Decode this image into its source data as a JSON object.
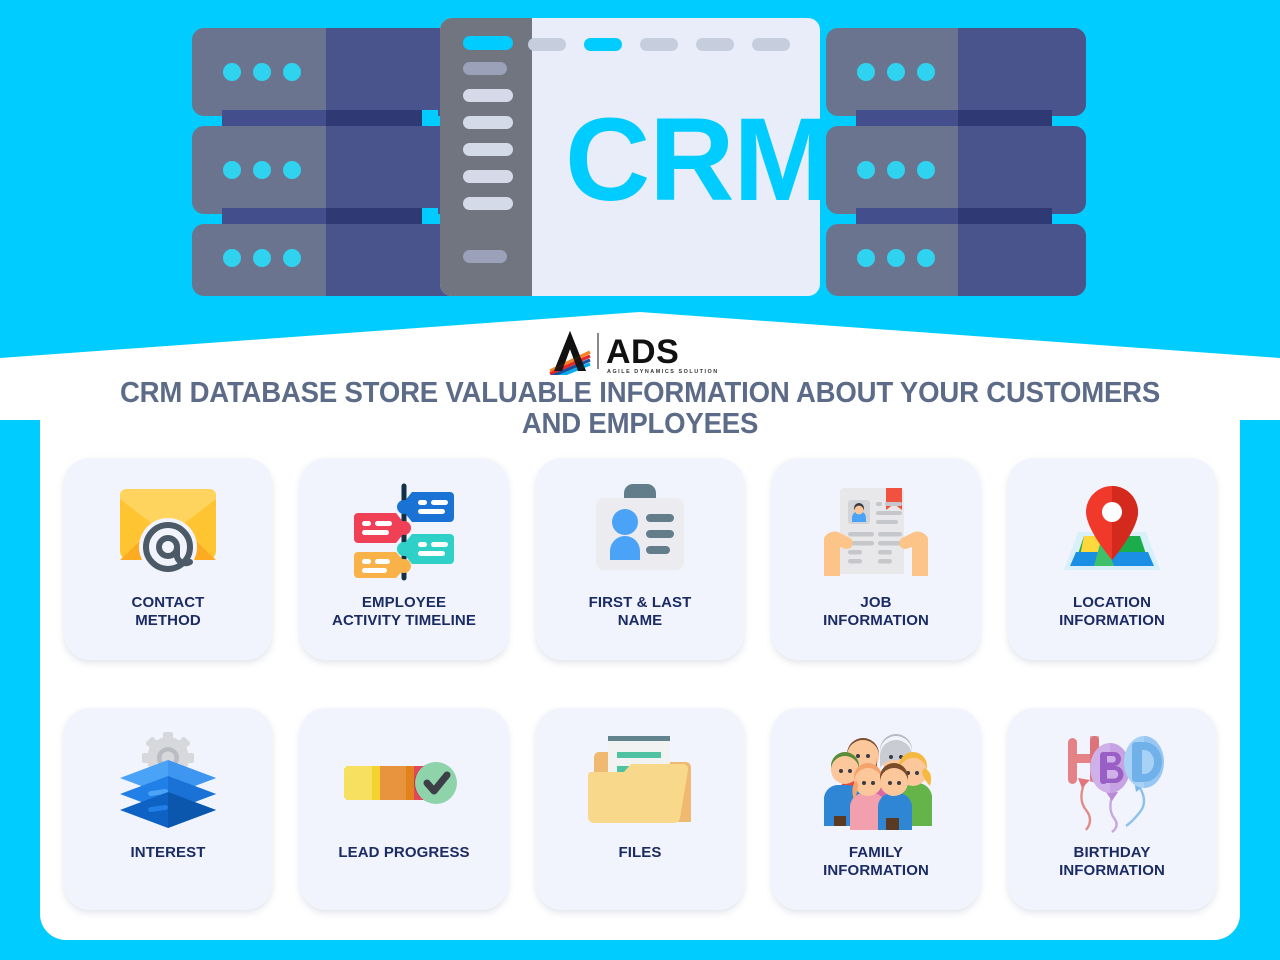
{
  "theme": {
    "background_color": "#00ccff",
    "panel_color": "#ffffff",
    "card_color": "#f2f4fd",
    "heading_color": "#5c6b87",
    "label_color": "#1b2b63",
    "crm_text_color": "#00ccff"
  },
  "hero": {
    "crm_label": "CRM",
    "nav_dots": [
      "inactive",
      "active",
      "inactive",
      "inactive",
      "inactive"
    ],
    "server_racks": 3,
    "server_lights_per_rack": 3
  },
  "logo": {
    "wordmark": "ADS",
    "tagline": "AGILE DYNAMICS SOLUTIONS",
    "mark_colors": [
      "#f58220",
      "#e8262a",
      "#1b4f9c",
      "#00aeef"
    ]
  },
  "heading": {
    "text": "CRM DATABASE STORE VALUABLE INFORMATION ABOUT YOUR CUSTOMERS AND EMPLOYEES"
  },
  "cards": [
    {
      "id": "contact-method",
      "icon": "envelope-at-icon",
      "label": "CONTACT\nMETHOD"
    },
    {
      "id": "employee-activity",
      "icon": "timeline-tags-icon",
      "label": "EMPLOYEE\nACTIVITY TIMELINE"
    },
    {
      "id": "first-last-name",
      "icon": "id-badge-icon",
      "label": "FIRST & LAST\nNAME"
    },
    {
      "id": "job-information",
      "icon": "resume-hands-icon",
      "label": "JOB\nINFORMATION"
    },
    {
      "id": "location-information",
      "icon": "map-pin-icon",
      "label": "LOCATION\nINFORMATION"
    },
    {
      "id": "interest",
      "icon": "layers-gear-icon",
      "label": "INTEREST"
    },
    {
      "id": "lead-progress",
      "icon": "progress-check-icon",
      "label": "LEAD PROGRESS"
    },
    {
      "id": "files",
      "icon": "folder-document-icon",
      "label": "FILES"
    },
    {
      "id": "family-information",
      "icon": "family-group-icon",
      "label": "FAMILY\nINFORMATION"
    },
    {
      "id": "birthday-information",
      "icon": "hbd-balloons-icon",
      "label": "BIRTHDAY\nINFORMATION"
    }
  ]
}
